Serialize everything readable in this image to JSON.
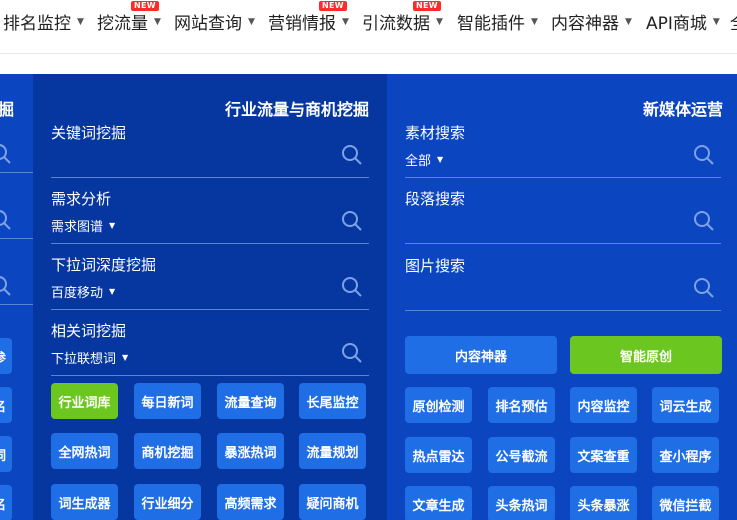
{
  "nav": {
    "items": [
      {
        "label": "排名监控",
        "badge": ""
      },
      {
        "label": "挖流量",
        "badge": "NEW"
      },
      {
        "label": "网站查询",
        "badge": ""
      },
      {
        "label": "营销情报",
        "badge": "NEW"
      },
      {
        "label": "引流数据",
        "badge": "NEW"
      },
      {
        "label": "智能插件",
        "badge": ""
      },
      {
        "label": "内容神器",
        "badge": ""
      },
      {
        "label": "API商城",
        "badge": ""
      }
    ],
    "overflow_char": "全"
  },
  "left_panel": {
    "title_fragment": "掘",
    "btn_fragments": [
      "参",
      "名",
      "词",
      "名"
    ]
  },
  "mid_panel": {
    "title": "行业流量与商机挖掘",
    "fields": [
      {
        "label": "关键词挖掘",
        "sub": ""
      },
      {
        "label": "需求分析",
        "sub": "需求图谱"
      },
      {
        "label": "下拉词深度挖掘",
        "sub": "百度移动"
      },
      {
        "label": "相关词挖掘",
        "sub": "下拉联想词"
      }
    ],
    "buttons": [
      [
        "行业词库",
        "每日新词",
        "流量查询",
        "长尾监控"
      ],
      [
        "全网热词",
        "商机挖掘",
        "暴涨热词",
        "流量规划"
      ],
      [
        "词生成器",
        "行业细分",
        "高频需求",
        "疑问商机"
      ]
    ]
  },
  "right_panel": {
    "title": "新媒体运营",
    "fields": [
      {
        "label": "素材搜索",
        "sub": "全部"
      },
      {
        "label": "段落搜索",
        "sub": ""
      },
      {
        "label": "图片搜索",
        "sub": ""
      }
    ],
    "big_buttons": [
      "内容神器",
      "智能原创"
    ],
    "buttons": [
      [
        "原创检测",
        "排名预估",
        "内容监控",
        "词云生成"
      ],
      [
        "热点雷达",
        "公号截流",
        "文案查重",
        "查小程序"
      ],
      [
        "文章生成",
        "头条热词",
        "头条暴涨",
        "微信拦截"
      ]
    ]
  },
  "colors": {
    "panel_dark": "#0637a0",
    "panel_light": "#0b45bf",
    "button_blue": "#1f6ee6",
    "button_green": "#6bc61f",
    "badge_red": "#ff2a2a"
  }
}
